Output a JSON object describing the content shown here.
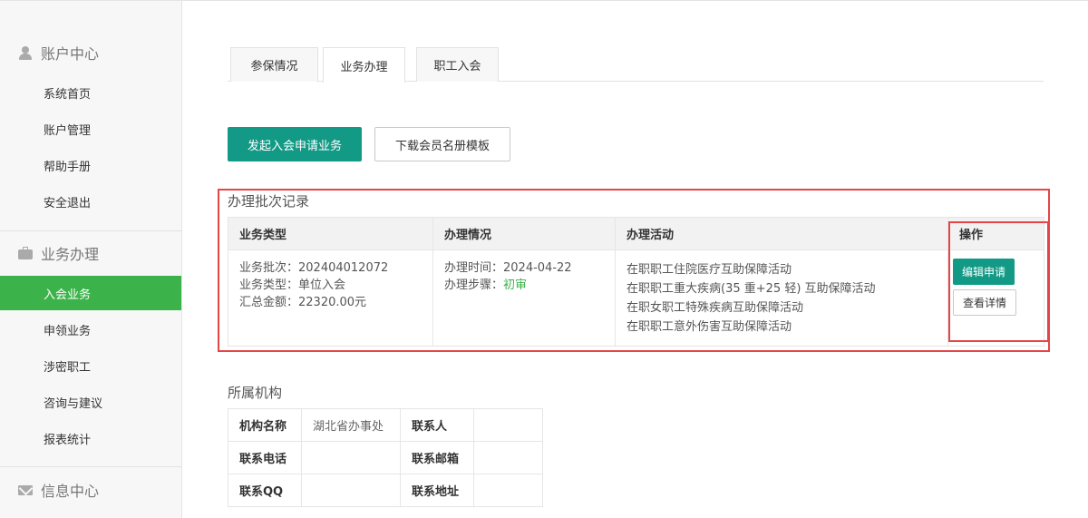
{
  "sidebar": {
    "sections": [
      {
        "title": "账户中心",
        "icon": "user-icon"
      },
      {
        "title": "业务办理",
        "icon": "briefcase-icon"
      },
      {
        "title": "信息中心",
        "icon": "envelope-icon"
      }
    ],
    "account_items": [
      "系统首页",
      "账户管理",
      "帮助手册",
      "安全退出"
    ],
    "business_items": [
      "入会业务",
      "申领业务",
      "涉密职工",
      "咨询与建议",
      "报表统计"
    ],
    "active_item": "入会业务"
  },
  "tabs": [
    "参保情况",
    "业务办理",
    "职工入会"
  ],
  "active_tab": "业务办理",
  "actions": {
    "start_label": "发起入会申请业务",
    "download_label": "下载会员名册模板"
  },
  "batch": {
    "title": "办理批次记录",
    "headers": [
      "业务类型",
      "办理情况",
      "办理活动",
      "操作"
    ],
    "row": {
      "batch_no": "业务批次：202404012072",
      "biz_type": "业务类型：单位入会",
      "total": "汇总金额：22320.00元",
      "time": "办理时间：2024-04-22",
      "step_label": "办理步骤：",
      "step_value": "初审",
      "activities": [
        "在职职工住院医疗互助保障活动",
        "在职职工重大疾病(35 重+25 轻) 互助保障活动",
        "在职女职工特殊疾病互助保障活动",
        "在职职工意外伤害互助保障活动"
      ],
      "edit_label": "编辑申请",
      "view_label": "查看详情"
    }
  },
  "org": {
    "title": "所属机构",
    "rows": [
      {
        "l1": "机构名称",
        "v1": "湖北省办事处",
        "l2": "联系人",
        "v2": ""
      },
      {
        "l1": "联系电话",
        "v1": "",
        "l2": "联系邮箱",
        "v2": ""
      },
      {
        "l1": "联系QQ",
        "v1": "",
        "l2": "联系地址",
        "v2": ""
      }
    ]
  },
  "colors": {
    "accent_green": "#3cb34a",
    "primary_teal": "#139a86",
    "highlight_red": "#e64545"
  }
}
